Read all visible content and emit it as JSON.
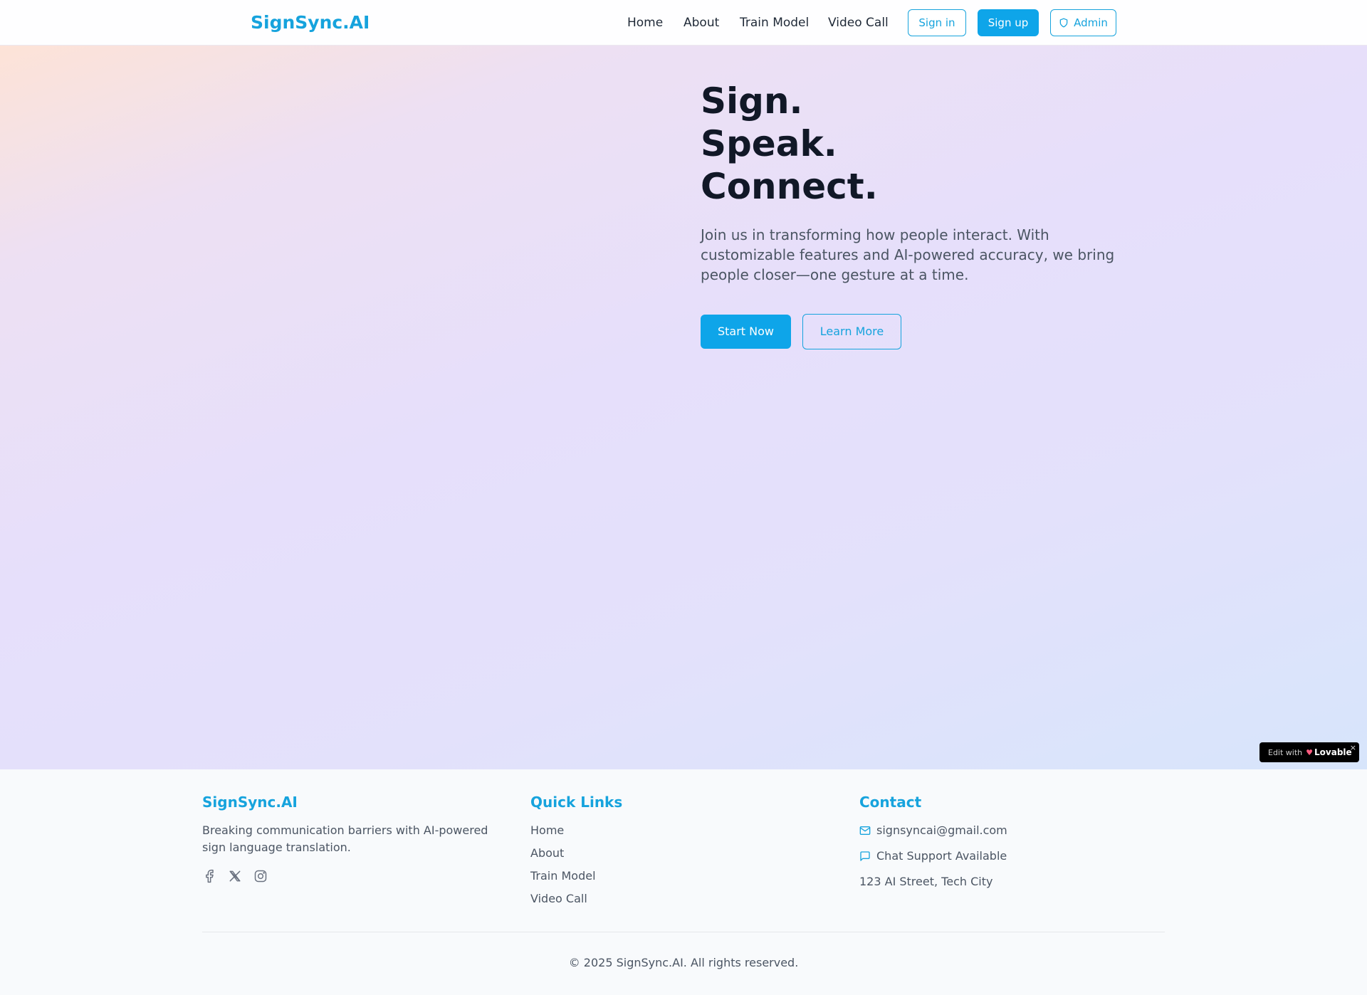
{
  "nav": {
    "brand": "SignSync.AI",
    "links": [
      "Home",
      "About",
      "Train Model",
      "Video Call"
    ],
    "sign_in": "Sign in",
    "sign_up": "Sign up",
    "admin": "Admin"
  },
  "hero": {
    "title_lines": [
      "Sign.",
      "Speak.",
      "Connect."
    ],
    "subtitle": "Join us in transforming how people interact. With customizable features and AI-powered accuracy, we bring people closer—one gesture at a time.",
    "start_now": "Start Now",
    "learn_more": "Learn More"
  },
  "lovable_badge": {
    "label": "Edit with",
    "brand": "Lovable",
    "close": "×"
  },
  "footer": {
    "brand": "SignSync.AI",
    "tagline": "Breaking communication barriers with AI-powered sign language translation.",
    "social_icons": [
      "facebook-icon",
      "x-twitter-icon",
      "instagram-icon"
    ],
    "quick_links_heading": "Quick Links",
    "quick_links": [
      "Home",
      "About",
      "Train Model",
      "Video Call"
    ],
    "contact_heading": "Contact",
    "email": "signsyncai@gmail.com",
    "chat": "Chat Support Available",
    "address": "123 AI Street, Tech City",
    "copyright": "© 2025 SignSync.AI. All rights reserved."
  },
  "colors": {
    "accent": "#16a3dd",
    "button": "#0ea5e9",
    "heading": "#111827",
    "body_text": "#4b5563"
  }
}
